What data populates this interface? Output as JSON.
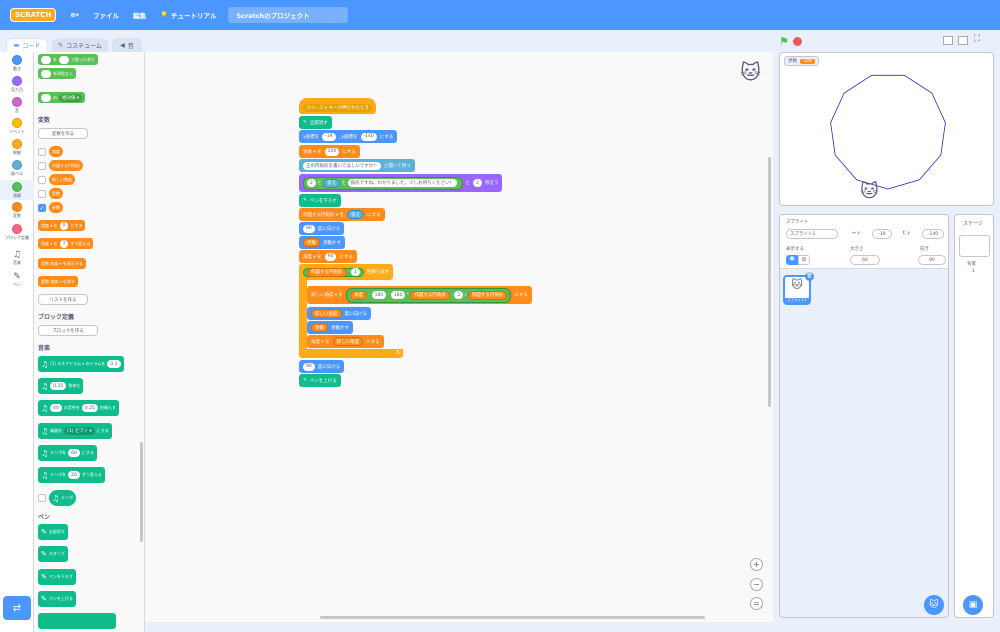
{
  "menubar": {
    "logo": "SCRATCH",
    "globe": "⊕▾",
    "file": "ファイル",
    "edit": "編集",
    "tutorial": "チュートリアル",
    "project_title": "Scratchのプロジェクト"
  },
  "tabs": {
    "code": "コード",
    "costumes": "コスチューム",
    "sounds": "音"
  },
  "categories": [
    "動き",
    "見た目",
    "音",
    "イベント",
    "制御",
    "調べる",
    "演算",
    "変数",
    "ブロック定義",
    "音楽",
    "ペン"
  ],
  "palette": {
    "b1": "を",
    "b1b": "で割った余り",
    "b2": "を四捨五入",
    "b3": "の",
    "b3b": "絶対値 ▾",
    "var_head": "変数",
    "make_var": "変数を作る",
    "vars": [
      "角度",
      "作図する円角形",
      "新しい角度",
      "変数",
      "歩数"
    ],
    "setvar": "角度 ▾ を",
    "setvar_v": "0",
    "setvar_t": "にする",
    "chgvar": "角度 ▾ を",
    "chgvar_v": "1",
    "chgvar_t": "ずつ変える",
    "showvar": "変数 角度 ▾ を表示する",
    "hidevar": "変数 角度 ▾ を隠す",
    "make_list": "リストを作る",
    "blk_head": "ブロック定義",
    "make_blk": "ブロックを作る",
    "music_head": "音楽",
    "drum": "(1) スネアドラム ▾ のドラムを",
    "drum_v": "0.2",
    "rest_v": "0.25",
    "rest_t": "拍休む",
    "note_v": "60",
    "note_t": "の音符を",
    "note_v2": "0.25",
    "note_t2": "拍鳴らす",
    "instr": "楽器を",
    "instr_v": "(1) ピアノ ▾",
    "instr_t": "にする",
    "tempo": "テンポを",
    "tempo_v": "60",
    "tempo_t": "にする",
    "tempo2": "テンポを",
    "tempo2_v": "20",
    "tempo2_t": "ずつ変える",
    "tempo3": "テンポ",
    "pen_head": "ペン",
    "pen1": "全部消す",
    "pen2": "スタンプ",
    "pen3": "ペンを下ろす",
    "pen4": "ペンを上げる"
  },
  "script": {
    "hat": "スペース ▾ キーが押されたとき",
    "clear": "全部消す",
    "goto1": "x座標を",
    "goto_x": "-19",
    "goto2": ", y座標を",
    "goto_y": "-140",
    "goto3": "にする",
    "steps1": "歩数 ▾ を",
    "steps_v": "100",
    "steps2": "にする",
    "ask": "正の円角形を書いてほしいですか？",
    "ask2": "と聞いて待つ",
    "say_v1": "2",
    "say1": "と",
    "say2": "答え",
    "say3": "と",
    "say4": "角形ですね。わかりました。少しお待ちください！",
    "say5": "と",
    "say_v2": "2",
    "say6": "秒言う",
    "pendown": "ペンを下ろす",
    "setn": "作図する円角形 ▾ を",
    "setn_v": "答え",
    "setn2": "にする",
    "turn1_v": "90",
    "turn1": "度に向ける",
    "move1_a": "歩数",
    "move1": "歩動かす",
    "ang1": "角度 ▾ を",
    "ang1_v": "90",
    "ang1b": "にする",
    "repeat_a": "作図する円角形",
    "repeat_op": "-",
    "repeat_v": "1",
    "repeat_t": "回繰り返す",
    "newang": "新しい角度 ▾ を",
    "na_a": "角度",
    "na_b": "180",
    "na_c": "180",
    "na_d": "作図する円角形",
    "na_e": "2",
    "na_f": "作図する円角形",
    "na_g": "にする",
    "turn2_a": "新しい角度",
    "turn2": "度に向ける",
    "move2_a": "歩数",
    "move2": "歩動かす",
    "ang2": "角度 ▾ を",
    "ang2_a": "新しい角度",
    "ang2b": "にする",
    "turn3_v": "90",
    "turn3": "度に向ける",
    "penup": "ペンを上げる"
  },
  "zoom": {
    "in": "+",
    "out": "−",
    "reset": "="
  },
  "stage": {
    "monitor_label": "歩数",
    "monitor_value": "100",
    "polygon_sides": 11
  },
  "sprite_panel": {
    "sprite_label": "スプライト",
    "sprite_name": "スプライト1",
    "x_label": "x",
    "x_value": "-19",
    "y_label": "y",
    "y_value": "-140",
    "show_label": "表示する",
    "size_label": "大きさ",
    "size_value": "60",
    "dir_label": "向き",
    "dir_value": "90",
    "thumb_label": "スプライト1"
  },
  "stage_panel": {
    "title": "ステージ",
    "backdrop_label": "背景",
    "backdrop_count": "1"
  }
}
